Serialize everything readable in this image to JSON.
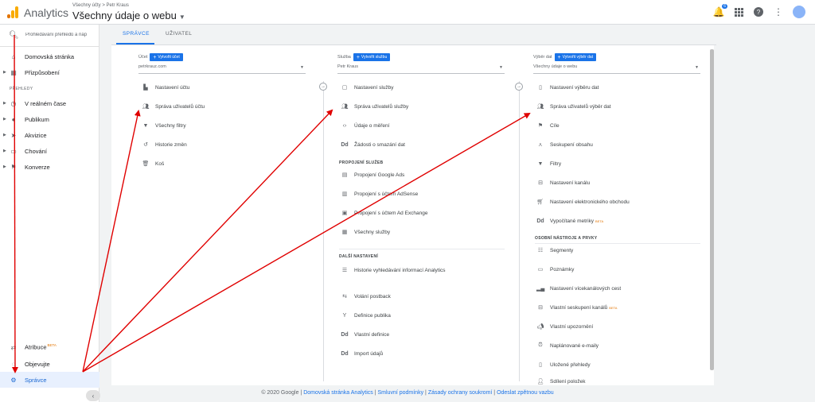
{
  "header": {
    "app_name": "Analytics",
    "breadcrumb": "Všechny účty > Petr Kraus",
    "property_title": "Všechny údaje o webu",
    "notification_count": "6"
  },
  "sidebar": {
    "search_placeholder": "Prohledávání přehledů a náp",
    "items": [
      {
        "label": "Domovská stránka",
        "icon": "home-icon"
      },
      {
        "label": "Přizpůsobení",
        "icon": "grid-icon"
      }
    ],
    "section_label": "PŘEHLEDY",
    "report_items": [
      {
        "label": "V reálném čase",
        "icon": "clock-icon"
      },
      {
        "label": "Publikum",
        "icon": "person-icon"
      },
      {
        "label": "Akvizice",
        "icon": "acquisition-icon"
      },
      {
        "label": "Chování",
        "icon": "behavior-icon"
      },
      {
        "label": "Konverze",
        "icon": "flag-icon"
      }
    ],
    "bottom_items": [
      {
        "label": "Atribuce",
        "beta": "BETA",
        "icon": "attribution-icon"
      },
      {
        "label": "Objevujte",
        "icon": "lightbulb-icon"
      },
      {
        "label": "Správce",
        "icon": "gear-icon"
      }
    ]
  },
  "tabs": [
    {
      "label": "SPRÁVCE"
    },
    {
      "label": "UŽIVATEL"
    }
  ],
  "account_column": {
    "label": "Účet",
    "create_label": "Vytvořit účet",
    "selected": "petrkrauz.com",
    "items": [
      {
        "label": "Nastavení účtu",
        "icon": "building-icon"
      },
      {
        "label": "Správa uživatelů účtu",
        "icon": "people-icon"
      },
      {
        "label": "Všechny filtry",
        "icon": "filter-icon"
      },
      {
        "label": "Historie změn",
        "icon": "history-icon"
      },
      {
        "label": "Koš",
        "icon": "trash-icon"
      }
    ]
  },
  "property_column": {
    "label": "Služba",
    "create_label": "Vytvořit službu",
    "selected": "Petr Kraus",
    "items": [
      {
        "label": "Nastavení služby",
        "icon": "window-icon"
      },
      {
        "label": "Správa uživatelů služby",
        "icon": "people-icon"
      },
      {
        "label": "Údaje o měření",
        "icon": "code-icon"
      },
      {
        "label": "Žádosti o smazání dat",
        "icon": "dd-icon"
      }
    ],
    "links_heading": "PROPOJENÍ SLUŽEB",
    "link_items": [
      {
        "label": "Propojení Google Ads",
        "icon": "ads-icon"
      },
      {
        "label": "Propojení s účtem AdSense",
        "icon": "adsense-icon"
      },
      {
        "label": "Propojení s účtem Ad Exchange",
        "icon": "adexchange-icon"
      },
      {
        "label": "Všechny služby",
        "icon": "all-products-icon"
      }
    ],
    "more_heading": "DALŠÍ NASTAVENÍ",
    "more_items": [
      {
        "label": "Historie vyhledávání informací Analytics",
        "icon": "search-history-icon"
      },
      {
        "label": "Volání postback",
        "icon": "postback-icon"
      },
      {
        "label": "Definice publika",
        "icon": "fork-icon"
      },
      {
        "label": "Vlastní definice",
        "icon": "dd-icon"
      },
      {
        "label": "Import údajů",
        "icon": "dd-icon"
      }
    ]
  },
  "view_column": {
    "label": "Výběr dat",
    "create_label": "Vytvořit výběr dat",
    "selected": "Všechny údaje o webu",
    "items": [
      {
        "label": "Nastavení výběru dat",
        "icon": "document-icon"
      },
      {
        "label": "Správa uživatelů výběr dat",
        "icon": "people-icon"
      },
      {
        "label": "Cíle",
        "icon": "flag-icon"
      },
      {
        "label": "Seskupení obsahu",
        "icon": "content-group-icon"
      },
      {
        "label": "Filtry",
        "icon": "filter-icon"
      },
      {
        "label": "Nastavení kanálu",
        "icon": "funnel-icon"
      },
      {
        "label": "Nastavení elektronického obchodu",
        "icon": "cart-icon"
      },
      {
        "label": "Vypočítané metriky",
        "beta": "BETA",
        "icon": "dd-icon"
      }
    ],
    "tools_heading": "OSOBNÍ NÁSTROJE A PRVKY",
    "tool_items": [
      {
        "label": "Segmenty",
        "icon": "segments-icon"
      },
      {
        "label": "Poznámky",
        "icon": "notes-icon"
      },
      {
        "label": "Nastavení vícekanálových cest",
        "icon": "bars-icon"
      },
      {
        "label": "Vlastní seskupení kanálů",
        "beta": "BETA",
        "icon": "channel-group-icon"
      },
      {
        "label": "Vlastní upozornění",
        "icon": "megaphone-icon"
      },
      {
        "label": "Naplánované e-maily",
        "icon": "alarm-icon"
      },
      {
        "label": "Uložené přehledy",
        "icon": "saved-icon"
      },
      {
        "label": "Sdílení položek",
        "icon": "share-person-icon"
      }
    ]
  },
  "footer": {
    "copyright": "© 2020 Google",
    "links": [
      "Domovská stránka Analytics",
      "Smluvní podmínky",
      "Zásady ochrany soukromí",
      "Odeslat zpětnou vazbu"
    ]
  },
  "colors": {
    "accent": "#1a73e8",
    "annotation": "#e00000",
    "beta": "#e37400"
  }
}
